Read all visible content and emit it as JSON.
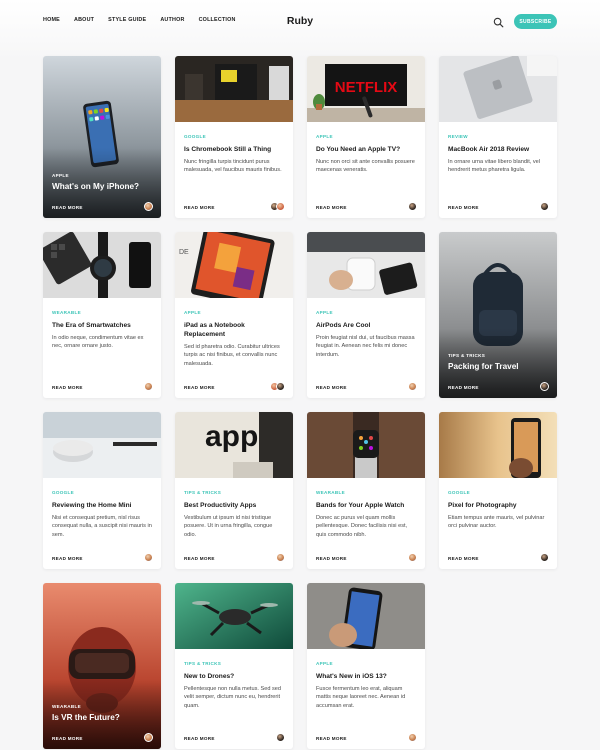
{
  "header": {
    "nav": [
      "HOME",
      "ABOUT",
      "STYLE GUIDE",
      "AUTHOR",
      "COLLECTION"
    ],
    "logo": "Ruby",
    "subscribe_label": "SUBSCRIBE",
    "search_icon": "search-icon",
    "accent": "#3cc4b7"
  },
  "cards": [
    {
      "category": "APPLE",
      "title": "What's on My iPhone?",
      "read_more": "READ MORE",
      "style": "full"
    },
    {
      "category": "GOOGLE",
      "title": "Is Chromebook Still a Thing",
      "excerpt": "Nunc fringilla turpis tincidunt purus malesuada, vel faucibus mauris finibus.",
      "read_more": "READ MORE"
    },
    {
      "category": "APPLE",
      "title": "Do You Need an Apple TV?",
      "excerpt": "Nunc non orci sit ante convallis posuere maecenas veneratis.",
      "read_more": "READ MORE"
    },
    {
      "category": "REVIEW",
      "title": "MacBook Air 2018 Review",
      "excerpt": "In ornare urna vitae libero blandit, vel hendrerit metus pharetra ligula.",
      "read_more": "READ MORE"
    },
    {
      "category": "WEARABLE",
      "title": "The Era of Smartwatches",
      "excerpt": "In odio neque, condimentum vitae ex nec, ornare ornare justo.",
      "read_more": "READ MORE"
    },
    {
      "category": "APPLE",
      "title": "iPad as a Notebook Replacement",
      "excerpt": "Sed id pharetra odio. Curabitur ultrices turpis ac nisi finibus, et convallis nunc malesuada.",
      "read_more": "READ MORE"
    },
    {
      "category": "APPLE",
      "title": "AirPods Are Cool",
      "excerpt": "Proin feugiat nisl dui, ut faucibus massa feugiat in. Aenean nec felis mi donec interdum.",
      "read_more": "READ MORE"
    },
    {
      "category": "TIPS & TRICKS",
      "title": "Packing for Travel",
      "read_more": "READ MORE",
      "style": "full"
    },
    {
      "category": "GOOGLE",
      "title": "Reviewing the Home Mini",
      "excerpt": "Nisi et consequat pretium, nisl risus consequat nulla, a suscipit nisi mauris in sem.",
      "read_more": "READ MORE"
    },
    {
      "category": "TIPS & TRICKS",
      "title": "Best Productivity Apps",
      "excerpt": "Vestibulum ut ipsum id nisi tristique posuere. Ut in urna fringilla, congue odio.",
      "read_more": "READ MORE"
    },
    {
      "category": "WEARABLE",
      "title": "Bands for Your Apple Watch",
      "excerpt": "Donec ac purus vel quam mollis pellentesque. Donec facilisis nisi est, quis commodo nibh.",
      "read_more": "READ MORE"
    },
    {
      "category": "GOOGLE",
      "title": "Pixel for Photography",
      "excerpt": "Etiam tempus ante mauris, vel pulvinar orci pulvinar auctor.",
      "read_more": "READ MORE"
    },
    {
      "category": "WEARABLE",
      "title": "Is VR the Future?",
      "read_more": "READ MORE",
      "style": "full"
    },
    {
      "category": "TIPS & TRICKS",
      "title": "New to Drones?",
      "excerpt": "Pellentesque non nulla metus. Sed sed velit semper, dictum nunc eu, hendrerit quam.",
      "read_more": "READ MORE"
    },
    {
      "category": "APPLE",
      "title": "What's New in iOS 13?",
      "excerpt": "Fusce fermentum leo erat, aliquam mattis neque laoreet nec. Aenean id accumsan erat.",
      "read_more": "READ MORE"
    }
  ]
}
